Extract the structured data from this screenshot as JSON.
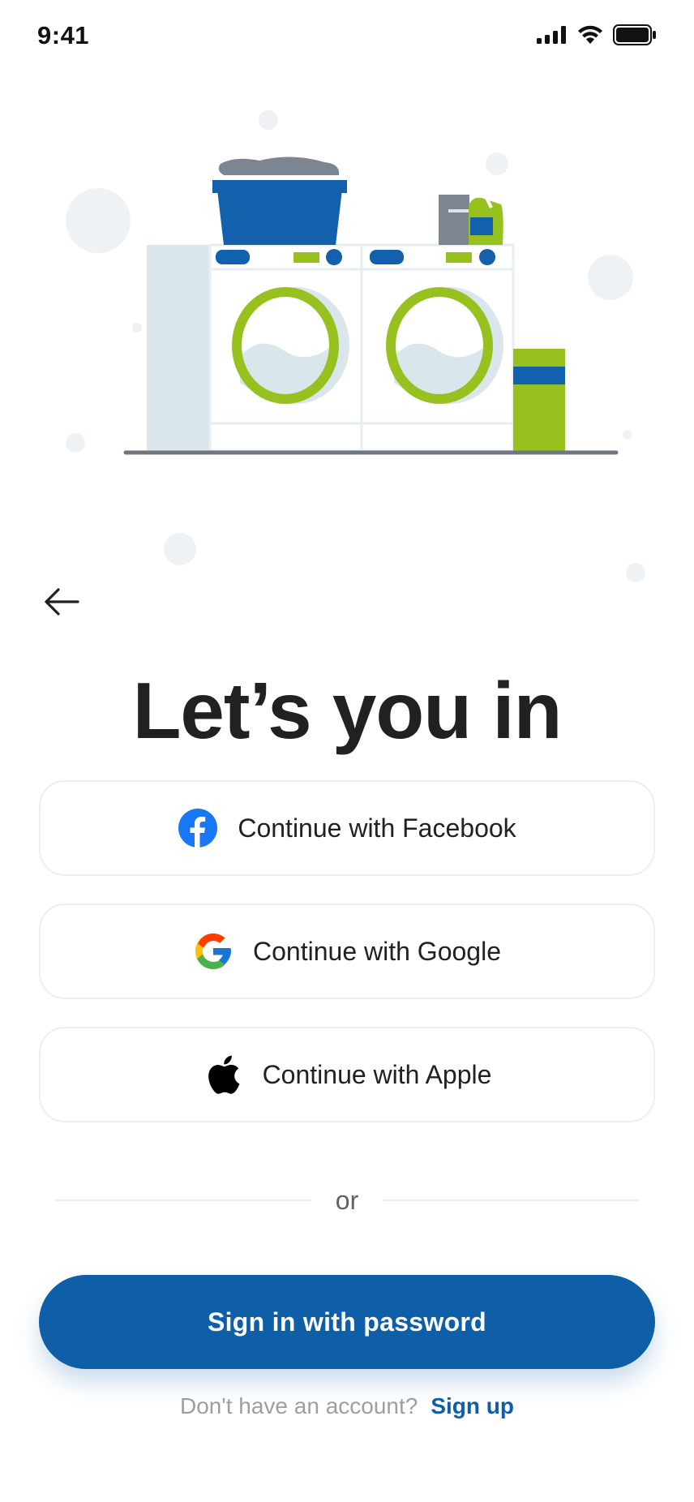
{
  "status_bar": {
    "time": "9:41",
    "icons": [
      "cellular-signal-icon",
      "wifi-icon",
      "battery-icon"
    ]
  },
  "illustration": {
    "subject": "laundry-machines-illustration",
    "colors": {
      "blue": "#1360ad",
      "green": "#97c11f",
      "light_gray": "#dbe5ec",
      "bubble": "#eef2f5"
    }
  },
  "nav": {
    "back_icon": "arrow-left-icon"
  },
  "title": "Let’s you in",
  "social": [
    {
      "label": "Continue with Facebook",
      "icon": "facebook-icon"
    },
    {
      "label": "Continue with Google",
      "icon": "google-icon"
    },
    {
      "label": "Continue with Apple",
      "icon": "apple-icon"
    }
  ],
  "divider_text": "or",
  "primary_button": "Sign in with password",
  "footer": {
    "prompt": "Don't have an account?",
    "link": "Sign up"
  },
  "colors": {
    "primary": "#0e5ea8",
    "text": "#212121",
    "muted": "#9e9e9e",
    "border": "#eeeeee"
  }
}
